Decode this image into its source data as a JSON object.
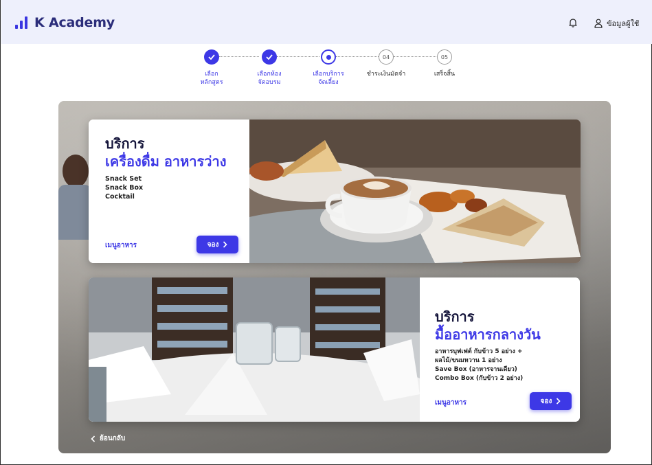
{
  "app": {
    "name": "K Academy"
  },
  "header": {
    "user_label": "ข้อมูลผู้ใช้"
  },
  "stepper": {
    "steps": [
      {
        "label_line1": "เลือก",
        "label_line2": "หลักสูตร",
        "state": "done",
        "number": ""
      },
      {
        "label_line1": "เลือกห้อง",
        "label_line2": "จัดอบรม",
        "state": "done",
        "number": ""
      },
      {
        "label_line1": "เลือกบริการ",
        "label_line2": "จัดเลี้ยง",
        "state": "current",
        "number": ""
      },
      {
        "label_line1": "ชำระเงินมัดจำ",
        "label_line2": "",
        "state": "todo",
        "number": "04"
      },
      {
        "label_line1": "เสร็จสิ้น",
        "label_line2": "",
        "state": "todo",
        "number": "05"
      }
    ]
  },
  "services": [
    {
      "title": "บริการ",
      "subtitle": "เครื่องดื่ม อาหารว่าง",
      "items": [
        "Snack Set",
        "Snack Box",
        "Cocktail"
      ],
      "menu_label": "เมนูอาหาร",
      "book_label": "จอง"
    },
    {
      "title": "บริการ",
      "subtitle": "มื้ออาหารกลางวัน",
      "items": [
        "อาหารบุฟเฟต์ กับข้าว 5 อย่าง +",
        "ผลไม้/ขนมหวาน 1 อย่าง",
        "Save Box (อาหารจานเดียว)",
        "Combo Box (กับข้าว 2 อย่าง)"
      ],
      "menu_label": "เมนูอาหาร",
      "book_label": "จอง"
    }
  ],
  "back_label": "ย้อนกลับ",
  "colors": {
    "accent": "#3d38e6",
    "header_bg": "#eef0fc",
    "logo_text": "#2b2d7a"
  },
  "icons": {
    "notification": "bell-icon",
    "user": "user-icon",
    "next": "chevron-right-icon",
    "back": "chevron-left-icon"
  }
}
